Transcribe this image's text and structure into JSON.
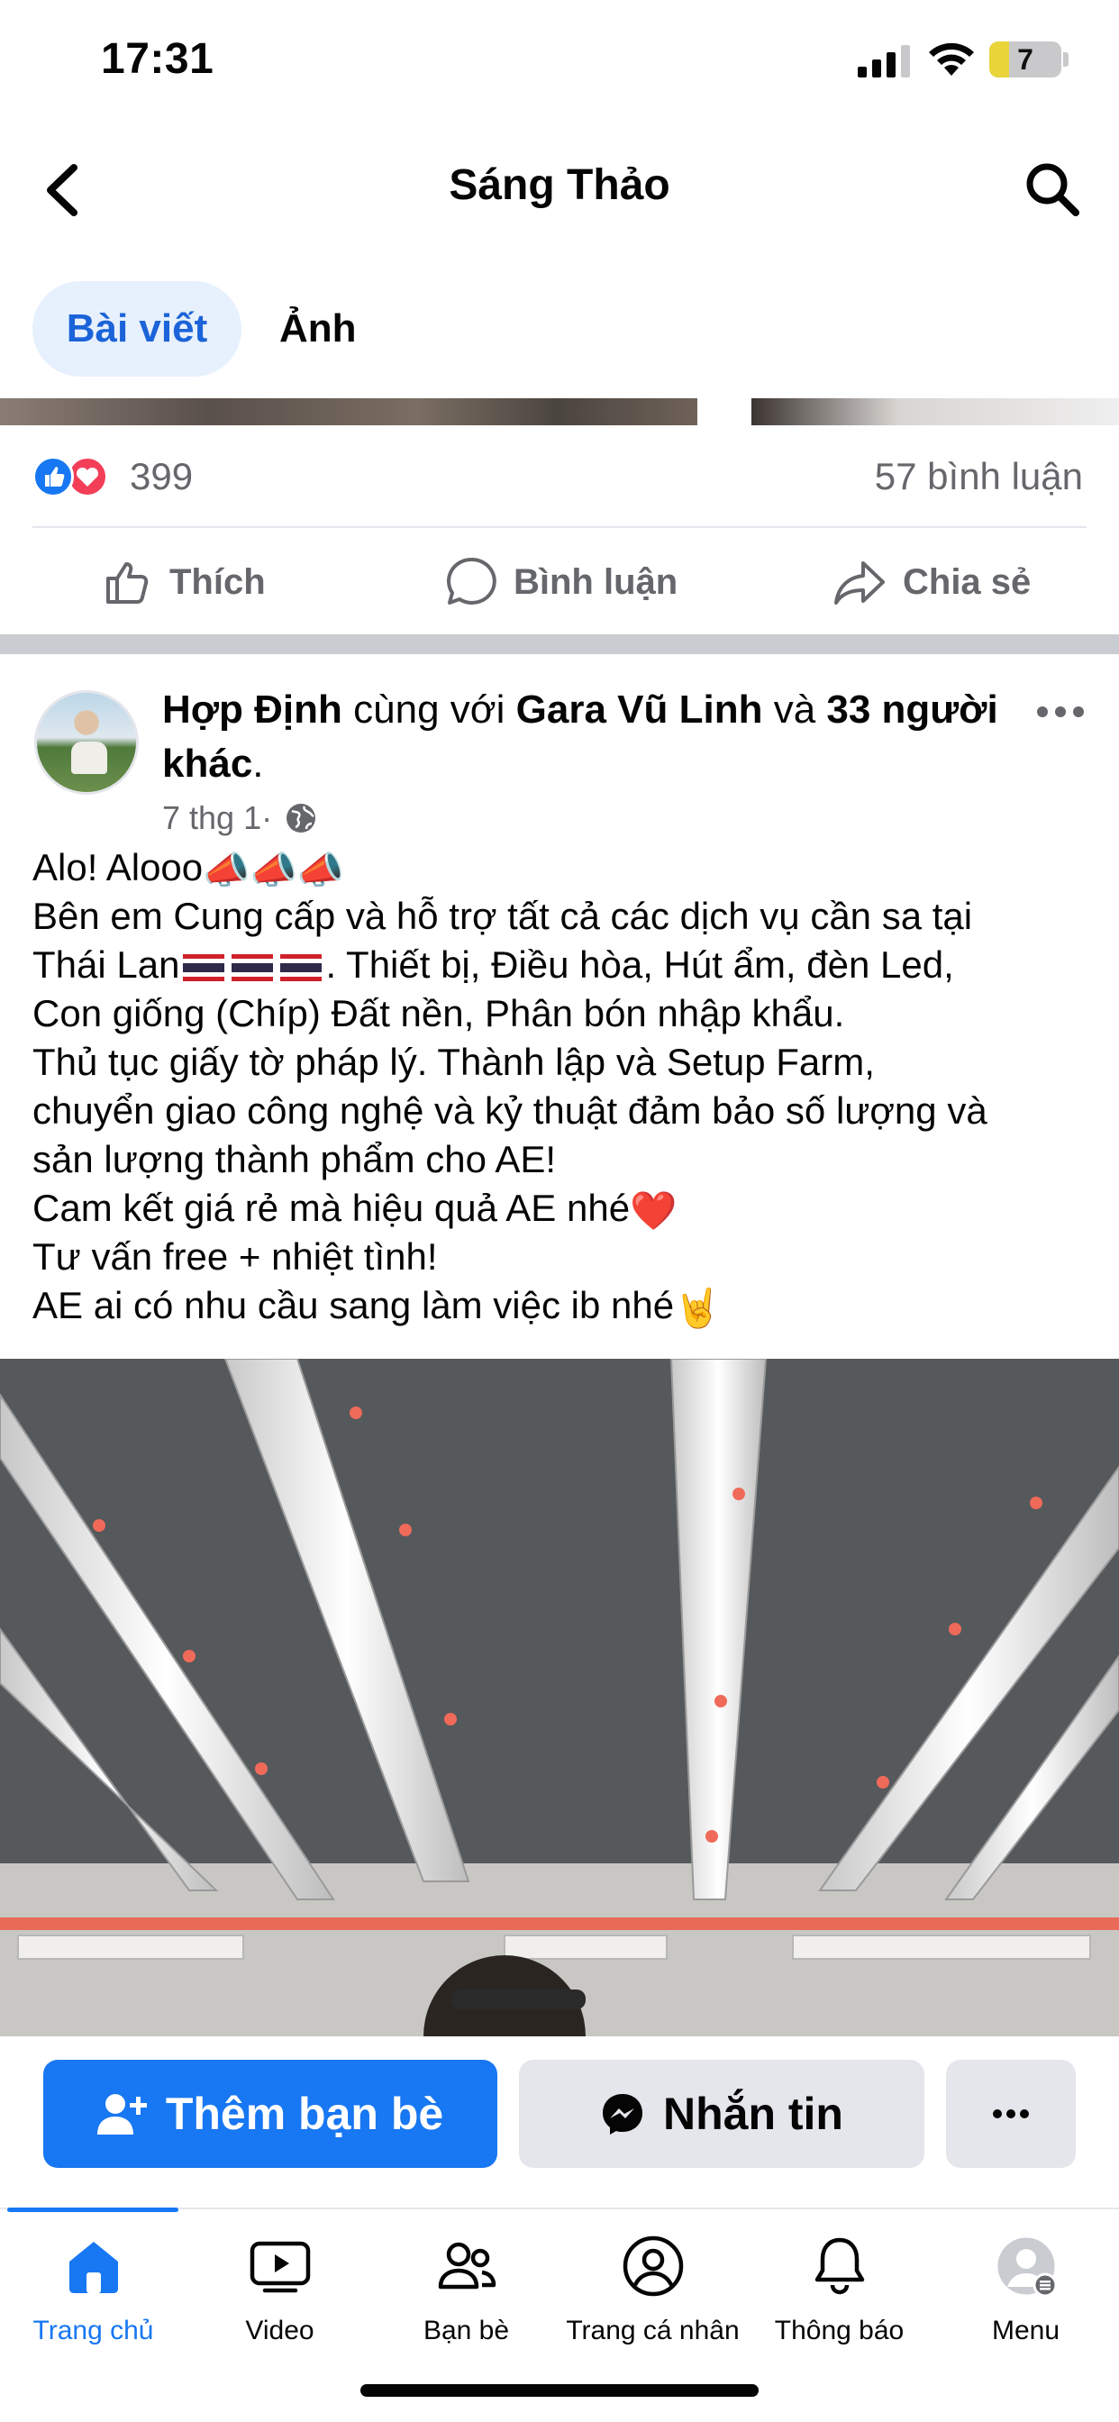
{
  "status_bar": {
    "time": "17:31",
    "battery": "7"
  },
  "header": {
    "title": "Sáng Thảo",
    "back_icon": "chevron-left-icon",
    "search_icon": "search-icon"
  },
  "tabs": [
    {
      "label": "Bài viết",
      "active": true
    },
    {
      "label": "Ảnh",
      "active": false
    }
  ],
  "previous_post": {
    "reaction_count": "399",
    "comment_count": "57 bình luận",
    "actions": {
      "like": "Thích",
      "comment": "Bình luận",
      "share": "Chia sẻ"
    }
  },
  "post": {
    "author": "Hợp Định",
    "with_text": " cùng với ",
    "tagged": "Gara Vũ Linh",
    "and_text": " và ",
    "others": "33 người khác",
    "others_suffix": ".",
    "time": "7 thg 1",
    "dot": " · ",
    "lines": {
      "l1": "Alo! Alooo",
      "l2": "Bên em Cung cấp và hỗ trợ tất cả các dịch vụ cần sa tại",
      "l3a": "Thái Lan",
      "l3b": ". Thiết bị, Điều hòa, Hút ẩm, đèn Led,",
      "l4": "Con giống (Chíp) Đất nền, Phân bón nhập khẩu.",
      "l5": "Thủ tục giấy tờ pháp lý. Thành lập và Setup Farm,",
      "l6": "chuyển giao công nghệ và kỷ thuật đảm bảo số lượng và",
      "l7": "sản lượng thành phẩm cho AE!",
      "l8": "Cam kết giá rẻ mà hiệu quả AE nhé",
      "l9": "Tư vấn free + nhiệt tình!",
      "l10": "AE ai có nhu cầu sang làm việc ib nhé"
    },
    "emojis": {
      "megaphone": "📣",
      "heart": "❤️",
      "rock_hand": "🤘"
    },
    "image_description_icon": "grow-light-photo"
  },
  "bottom_actions": {
    "add_friend": "Thêm bạn bè",
    "message": "Nhắn tin"
  },
  "tabbar": [
    {
      "label": "Trang chủ",
      "icon": "home-icon",
      "active": true
    },
    {
      "label": "Video",
      "icon": "video-icon",
      "active": false
    },
    {
      "label": "Bạn bè",
      "icon": "friends-icon",
      "active": false
    },
    {
      "label": "Trang cá nhân",
      "icon": "profile-icon",
      "active": false
    },
    {
      "label": "Thông báo",
      "icon": "bell-icon",
      "active": false
    },
    {
      "label": "Menu",
      "icon": "menu-avatar-icon",
      "active": false
    }
  ],
  "colors": {
    "accent": "#1877f2",
    "like": "#1877f2",
    "love": "#f33e58",
    "secondary_text": "#65676b"
  }
}
